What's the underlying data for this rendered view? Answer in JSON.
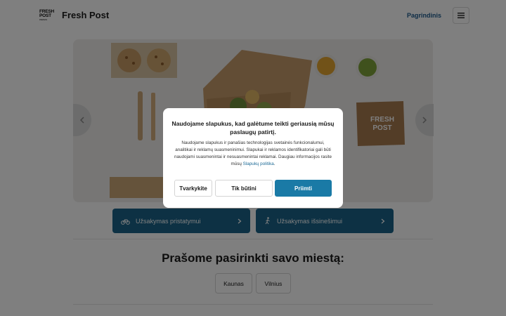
{
  "header": {
    "logo_line1": "FRESH",
    "logo_line2": "POST",
    "logo_sub": "PARDAS",
    "brand": "Fresh Post",
    "nav_link": "Pagrindinis"
  },
  "hero": {
    "box_label_line1": "FRESH",
    "box_label_line2": "POST"
  },
  "actions": {
    "delivery": "Užsakymas pristatymui",
    "pickup": "Užsakymas išsinešimui"
  },
  "city": {
    "title": "Prašome pasirinkti savo miestą:",
    "options": [
      "Kaunas",
      "Vilnius"
    ]
  },
  "cookie": {
    "title": "Naudojame slapukus, kad galėtume teikti geriausią mūsų paslaugų patirtį.",
    "body": "Naudojame slapukus ir panašias technologijas svetainės funkcionalumui, analitikai ir reklamų suasmeninimui. Slapukai ir reklamos identifikatoriai gali būti naudojami suasmenintai ir nesuasmenintai reklamai. Daugiau informacijos rasite mūsų",
    "link": "Slapukų politika",
    "manage": "Tvarkykite",
    "only": "Tik būtini",
    "accept": "Priimti"
  },
  "colors": {
    "accent": "#1a6389",
    "accept": "#1a7aa6",
    "link": "#1c5a8c"
  }
}
